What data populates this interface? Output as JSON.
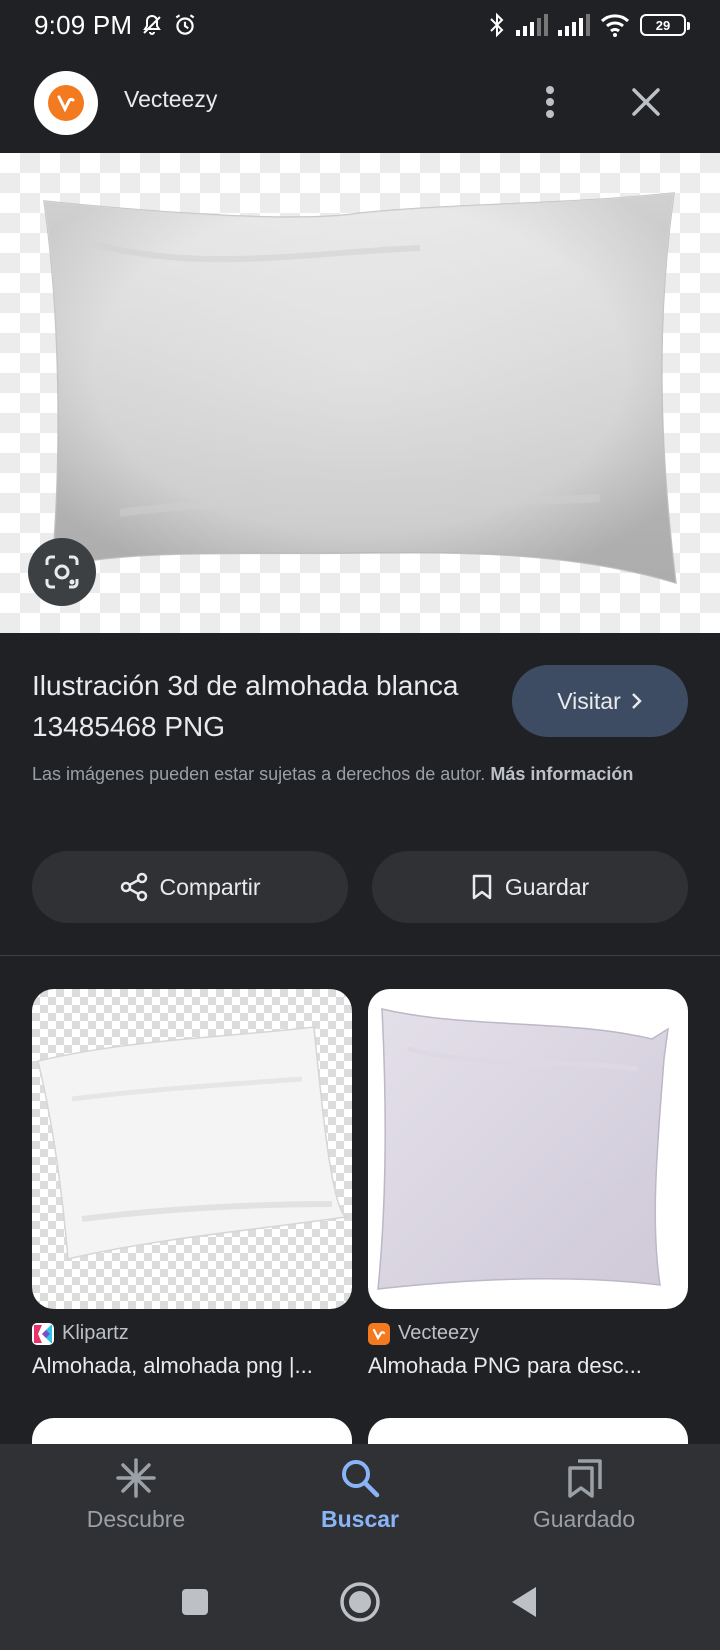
{
  "status_bar": {
    "time": "9:09 PM",
    "battery": "29",
    "icons": [
      "notifications-off-icon",
      "alarm-icon",
      "bluetooth-icon",
      "signal-icon",
      "signal-icon",
      "wifi-icon",
      "battery-icon"
    ]
  },
  "header": {
    "site_name": "Vecteezy",
    "logo_icon": "vecteezy-logo-icon",
    "more_icon": "more-vert-icon",
    "close_icon": "close-icon"
  },
  "detail": {
    "title": "Ilustración 3d de almohada blanca 13485468 PNG",
    "visit_label": "Visitar",
    "copyright_text": "Las imágenes pueden estar sujetas a derechos de autor.",
    "more_info_label": "Más información",
    "share_label": "Compartir",
    "save_label": "Guardar"
  },
  "results": [
    {
      "source": "Klipartz",
      "title": "Almohada, almohada png |..."
    },
    {
      "source": "Vecteezy",
      "title": "Almohada PNG para desc..."
    }
  ],
  "bottom_nav": {
    "items": [
      {
        "label": "Descubre",
        "icon": "asterisk-icon"
      },
      {
        "label": "Buscar",
        "icon": "search-icon"
      },
      {
        "label": "Guardado",
        "icon": "bookmarks-icon"
      }
    ],
    "active": "Buscar"
  },
  "colors": {
    "background": "#202124",
    "accent": "#8ab4f8",
    "visit_button": "#3e4c63",
    "vecteezy_orange": "#f47a20"
  }
}
